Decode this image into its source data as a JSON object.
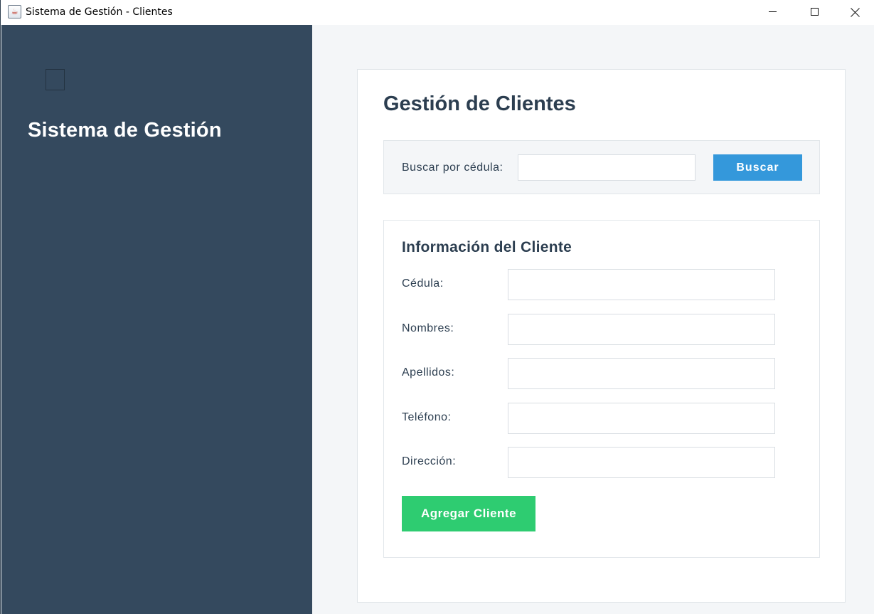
{
  "window": {
    "title": "Sistema de Gestión - Clientes",
    "icon": "java-cup-icon",
    "controls": [
      "minimize-icon",
      "maximize-icon",
      "close-icon"
    ]
  },
  "sidebar": {
    "title": "Sistema de Gestión",
    "background": "#34495e"
  },
  "main": {
    "title": "Gestión de Clientes",
    "search": {
      "label": "Buscar por cédula:",
      "value": "",
      "button_label": "Buscar",
      "button_color": "#3498db"
    },
    "form": {
      "title": "Información del Cliente",
      "fields": [
        {
          "label": "Cédula:",
          "value": ""
        },
        {
          "label": "Nombres:",
          "value": ""
        },
        {
          "label": "Apellidos:",
          "value": ""
        },
        {
          "label": "Teléfono:",
          "value": ""
        },
        {
          "label": "Dirección:",
          "value": ""
        }
      ],
      "submit_label": "Agregar Cliente",
      "submit_color": "#2ecc71"
    }
  }
}
